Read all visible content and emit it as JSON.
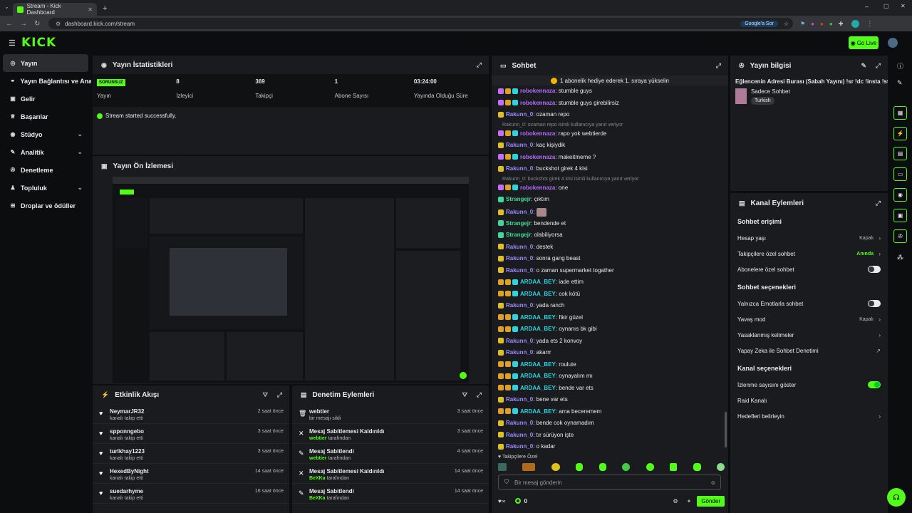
{
  "browser": {
    "tab_title": "Stream - Kick Dashboard",
    "url": "dashboard.kick.com/stream",
    "google_btn": "Google'a Sor"
  },
  "header": {
    "logo": "KICK",
    "go_live": "Go Live"
  },
  "sidebar": {
    "items": [
      {
        "label": "Yayın",
        "icon": "broadcast-icon"
      },
      {
        "label": "Yayın Bağlantısı ve Anahtarı",
        "icon": "link-icon"
      },
      {
        "label": "Gelir",
        "icon": "money-icon"
      },
      {
        "label": "Başarılar",
        "icon": "trophy-icon"
      },
      {
        "label": "Stüdyo",
        "icon": "studio-icon"
      },
      {
        "label": "Analitik",
        "icon": "chart-icon"
      },
      {
        "label": "Denetleme",
        "icon": "wrench-icon"
      },
      {
        "label": "Topluluk",
        "icon": "users-icon"
      },
      {
        "label": "Droplar ve ödüller",
        "icon": "gift-icon"
      }
    ]
  },
  "stats": {
    "title": "Yayın İstatistikleri",
    "status_badge": "SORUNSUZ",
    "items": [
      {
        "label": "Yayın",
        "value": ""
      },
      {
        "label": "İzleyici",
        "value": "8"
      },
      {
        "label": "Takipçi",
        "value": "369"
      },
      {
        "label": "Abone Sayısı",
        "value": "1"
      },
      {
        "label": "Yayında Olduğu Süre",
        "value": "03:24:00"
      }
    ],
    "ok_message": "Stream started successfully."
  },
  "preview": {
    "title": "Yayın Ön İzlemesi"
  },
  "activity": {
    "title": "Etkinlik Akışı",
    "items": [
      {
        "name": "NeymarJR32",
        "sub": "kanalı takip etti",
        "time": "2 saat önce"
      },
      {
        "name": "spponngebo",
        "sub": "kanalı takip etti",
        "time": "3 saat önce"
      },
      {
        "name": "turlkhay1223",
        "sub": "kanalı takip etti",
        "time": "3 saat önce"
      },
      {
        "name": "HexedByNight",
        "sub": "kanalı takip etti",
        "time": "14 saat önce"
      },
      {
        "name": "suedarhyme",
        "sub": "kanalı takip etti",
        "time": "16 saat önce"
      }
    ]
  },
  "moderation": {
    "title": "Denetim Eylemleri",
    "items": [
      {
        "name": "webtier",
        "actor": "",
        "sub": "bir mesajı sildi",
        "time": "3 saat önce"
      },
      {
        "name": "Mesaj Sabitlemesi Kaldırıldı",
        "actor": "webtier",
        "sub": " tarafından",
        "time": "3 saat önce"
      },
      {
        "name": "Mesaj Sabitlendi",
        "actor": "webtier",
        "sub": " tarafından",
        "time": "4 saat önce"
      },
      {
        "name": "Mesaj Sabitlemesi Kaldırıldı",
        "actor": "BeXKa",
        "sub": " tarafından",
        "time": "14 saat önce"
      },
      {
        "name": "Mesaj Sabitlendi",
        "actor": "BeXKa",
        "sub": " tarafından",
        "time": "14 saat önce"
      }
    ]
  },
  "chat": {
    "title": "Sohbet",
    "banner": "1 abonelik hediye ederek 1. sıraya yükselin",
    "messages": [
      {
        "user": "robokennaza",
        "text": ": stumble guys",
        "color": "#b36bff",
        "reply": ""
      },
      {
        "user": "robokennaza",
        "text": ": stumble guys girebilirsiz",
        "color": "#b36bff",
        "reply": ""
      },
      {
        "user": "Rakunn_0",
        "text": ": ozaman repo",
        "color": "#9a8cff",
        "reply": ""
      },
      {
        "user": "robokennaza",
        "text": ": rapo yok webtierde",
        "color": "#b36bff",
        "reply": "Rakunn_0: ozaman repo isimli kullanıcıya yanıt veriyor"
      },
      {
        "user": "Rakunn_0",
        "text": ": kaç kişiydik",
        "color": "#9a8cff",
        "reply": ""
      },
      {
        "user": "robokennaza",
        "text": ": makeitmeme ?",
        "color": "#b36bff",
        "reply": ""
      },
      {
        "user": "Rakunn_0",
        "text": ": buckshot girek 4 kisi",
        "color": "#9a8cff",
        "reply": ""
      },
      {
        "user": "robokennaza",
        "text": ": one",
        "color": "#b36bff",
        "reply": "Rakunn_0: buckshot girek 4 kisi isimli kullanıcıya yanıt veriyor"
      },
      {
        "user": "Strangejr",
        "text": ": çıktım",
        "color": "#3ed99a",
        "reply": ""
      },
      {
        "user": "Rakunn_0",
        "text": ":",
        "color": "#9a8cff",
        "reply": ""
      },
      {
        "user": "Strangejr",
        "text": ": bendende et",
        "color": "#3ed99a",
        "reply": ""
      },
      {
        "user": "Strangejr",
        "text": ": olabiliyorsa",
        "color": "#3ed99a",
        "reply": ""
      },
      {
        "user": "Rakunn_0",
        "text": ": destek",
        "color": "#9a8cff",
        "reply": ""
      },
      {
        "user": "Rakunn_0",
        "text": ": sonra gang beast",
        "color": "#9a8cff",
        "reply": ""
      },
      {
        "user": "Rakunn_0",
        "text": ": o zaman supermarket togather",
        "color": "#9a8cff",
        "reply": ""
      },
      {
        "user": "ARDAA_BEY",
        "text": ": iade ettim",
        "color": "#2ad4e0",
        "reply": ""
      },
      {
        "user": "ARDAA_BEY",
        "text": ": cok kötü",
        "color": "#2ad4e0",
        "reply": ""
      },
      {
        "user": "Rakunn_0",
        "text": ": yada ranch",
        "color": "#9a8cff",
        "reply": ""
      },
      {
        "user": "ARDAA_BEY",
        "text": ": fikir güzel",
        "color": "#2ad4e0",
        "reply": ""
      },
      {
        "user": "ARDAA_BEY",
        "text": ": oynanıs bk gibi",
        "color": "#2ad4e0",
        "reply": ""
      },
      {
        "user": "Rakunn_0",
        "text": ": yada ets 2 konvoy",
        "color": "#9a8cff",
        "reply": ""
      },
      {
        "user": "Rakunn_0",
        "text": ": akarrr",
        "color": "#9a8cff",
        "reply": ""
      },
      {
        "user": "ARDAA_BEY",
        "text": ": roulute",
        "color": "#2ad4e0",
        "reply": ""
      },
      {
        "user": "ARDAA_BEY",
        "text": ": oynayalım mı",
        "color": "#2ad4e0",
        "reply": ""
      },
      {
        "user": "ARDAA_BEY",
        "text": ": bende var ets",
        "color": "#2ad4e0",
        "reply": ""
      },
      {
        "user": "Rakunn_0",
        "text": ": bene var ets",
        "color": "#9a8cff",
        "reply": ""
      },
      {
        "user": "ARDAA_BEY",
        "text": ": ama beceremem",
        "color": "#2ad4e0",
        "reply": ""
      },
      {
        "user": "Rakunn_0",
        "text": ": bende cok oynamadım",
        "color": "#9a8cff",
        "reply": ""
      },
      {
        "user": "Rakunn_0",
        "text": ": tır sürüyon işte",
        "color": "#9a8cff",
        "reply": ""
      },
      {
        "user": "Rakunn_0",
        "text": ": o kadar",
        "color": "#9a8cff",
        "reply": ""
      }
    ],
    "followers_only": "Takipçilere Özel",
    "input_placeholder": "Bir mesaj gönderin",
    "points": "0",
    "send": "Gönder"
  },
  "stream_info": {
    "title": "Yayın bilgisi",
    "stream_title": "Eğlencenin Adresi Burası (Sabah Yayını) !sr !dc !insta !steam",
    "category": "Sadece Sohbet",
    "tag": "Turkish"
  },
  "channel_actions": {
    "title": "Kanal Eylemleri",
    "chat_access": "Sohbet erişimi",
    "account_age": "Hesap yaşı",
    "account_age_val": "Kapalı",
    "followers_chat": "Takipçilere özel sohbet",
    "followers_chat_val": "Anında",
    "subs_chat": "Abonelere özel sohbet",
    "chat_options": "Sohbet seçenekleri",
    "emote_only": "Yalnızca Emotlarla sohbet",
    "slow_mode": "Yavaş mod",
    "slow_mode_val": "Kapalı",
    "banned_words": "Yasaklanmış kelimeler",
    "ai_mod": "Yapay Zeka ile Sohbet Denetimi",
    "channel_options": "Kanal seçenekleri",
    "show_viewers": "İzlenme sayısını göster",
    "raid": "Raid Kanalı",
    "goals": "Hedefleri belirleyin"
  }
}
